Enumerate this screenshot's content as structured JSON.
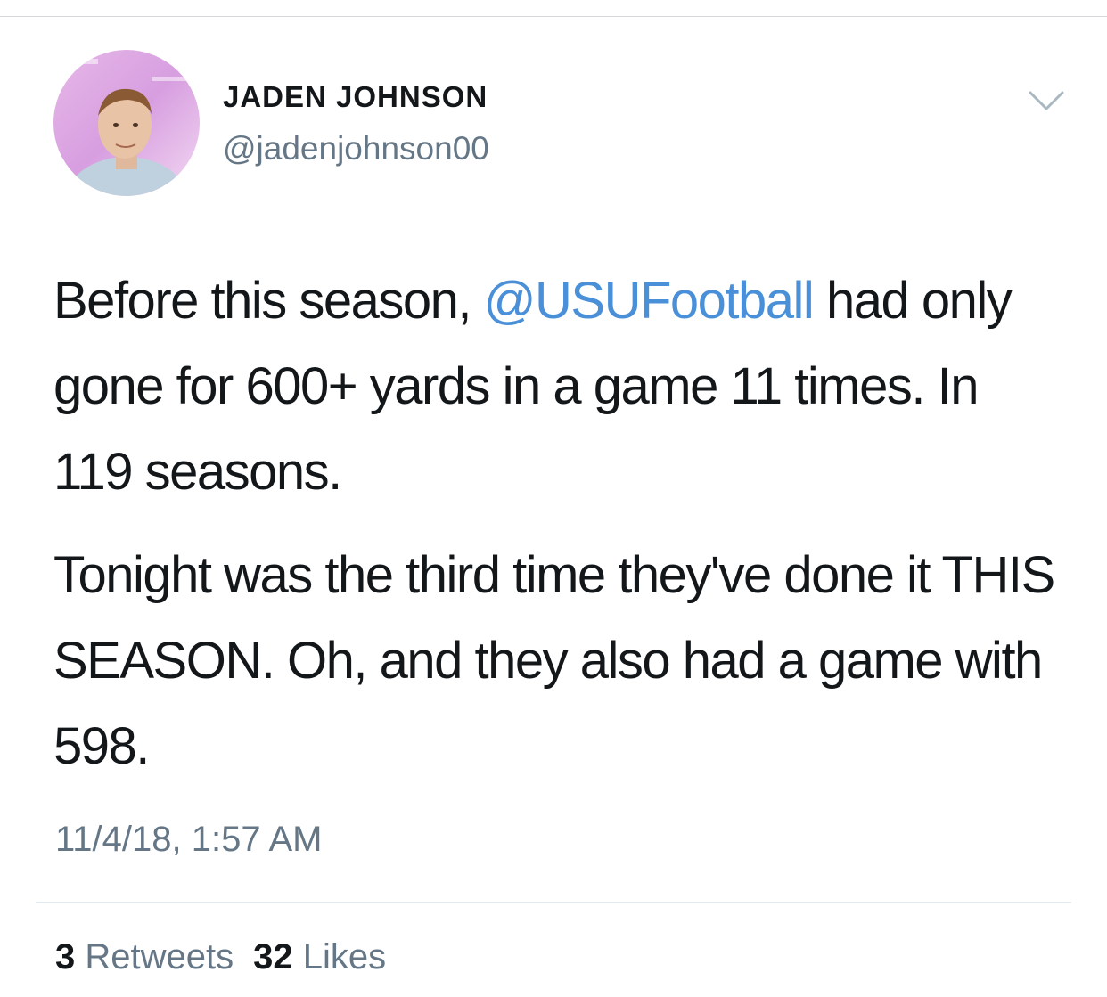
{
  "tweet": {
    "author": {
      "display_name": "JADEN JOHNSON",
      "handle": "@jadenjohnson00",
      "avatar_icon": "profile-photo"
    },
    "menu_icon": "chevron-down-icon",
    "body": {
      "para1_before": "Before this season, ",
      "para1_mention": "@USUFootball",
      "para1_after": " had only gone for 600+ yards in a game 11 times. In 119 seasons.",
      "para2": "Tonight was the third time they've done it THIS SEASON. Oh, and they also had a game with 598."
    },
    "timestamp": "11/4/18, 1:57 AM",
    "stats": {
      "retweets_count": "3",
      "retweets_label": "Retweets",
      "likes_count": "32",
      "likes_label": "Likes"
    }
  },
  "colors": {
    "mention": "#4a90d9",
    "secondary_text": "#657786",
    "primary_text": "#14171a"
  }
}
